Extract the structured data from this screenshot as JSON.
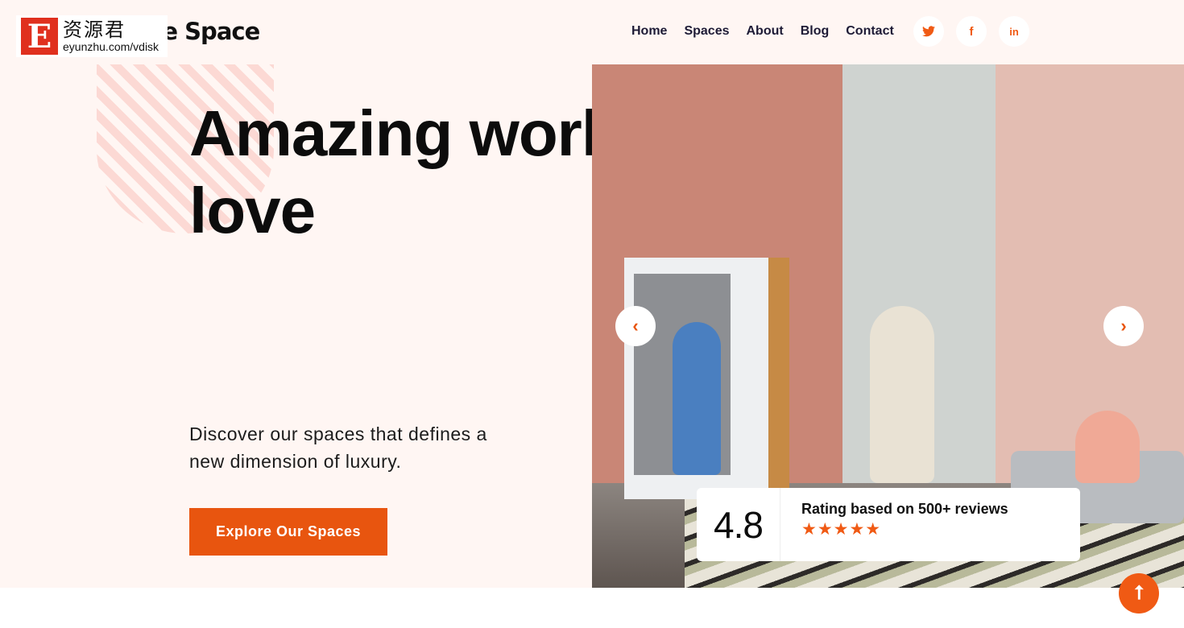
{
  "header": {
    "brand": "Share Space",
    "watermark": {
      "letter": "E",
      "cn": "资源君",
      "url": "eyunzhu.com/vdisk"
    },
    "nav": [
      "Home",
      "Spaces",
      "About",
      "Blog",
      "Contact"
    ],
    "social": [
      {
        "icon": "twitter-icon",
        "glyph": "🐦"
      },
      {
        "icon": "facebook-icon",
        "glyph": "f"
      },
      {
        "icon": "linkedin-icon",
        "glyph": "in"
      }
    ]
  },
  "hero": {
    "title": "Amazing workspace you will love",
    "subtitle": "Discover our spaces that defines a new dimension of luxury.",
    "cta": "Explore Our Spaces"
  },
  "carousel": {
    "prev": "‹",
    "next": "›"
  },
  "rating": {
    "score": "4.8",
    "label": "Rating based on 500+ reviews",
    "stars": 5,
    "stars_text": "★★★★★"
  },
  "scroll_top": "⭡",
  "colors": {
    "accent": "#e8550f",
    "background": "#fff6f3"
  }
}
